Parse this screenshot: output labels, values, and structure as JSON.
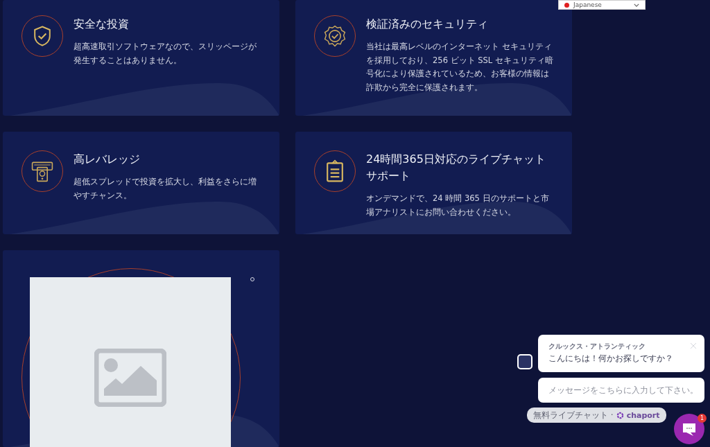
{
  "language_select": {
    "value": "Japanese"
  },
  "features": [
    {
      "kind": "shield",
      "title": "安全な投資",
      "description": "超高速取引ソフトウェアなので、スリッページが発生することはありません。"
    },
    {
      "kind": "badge",
      "title": "検証済みのセキュリティ",
      "description": "当社は最高レベルのインターネット セキュリティを採用しており、256 ビット SSL セキュリティ暗号化により保護されているため、お客様の情報は詐欺から完全に保護されます。"
    },
    {
      "kind": "atm",
      "title": "高レバレッジ",
      "description": "超低スプレッドで投資を拡大し、利益をさらに増やすチャンス。"
    },
    {
      "kind": "clipboard",
      "title": "24時間365日対応のライブチャットサポート",
      "description": "オンデマンドで、24 時間 365 日のサポートと市場アナリストにお問い合わせください。"
    }
  ],
  "image_card": {
    "kind": "placeholder"
  },
  "chat": {
    "agent_name": "クルックス・アトランティック",
    "greeting": "こんにちは！何かお探しですか？",
    "input": {
      "placeholder": "メッセージをこちらに入力して下さい。"
    },
    "powered_by": "無料ライブチャット ·",
    "brand": "chaport",
    "unread": "1"
  }
}
